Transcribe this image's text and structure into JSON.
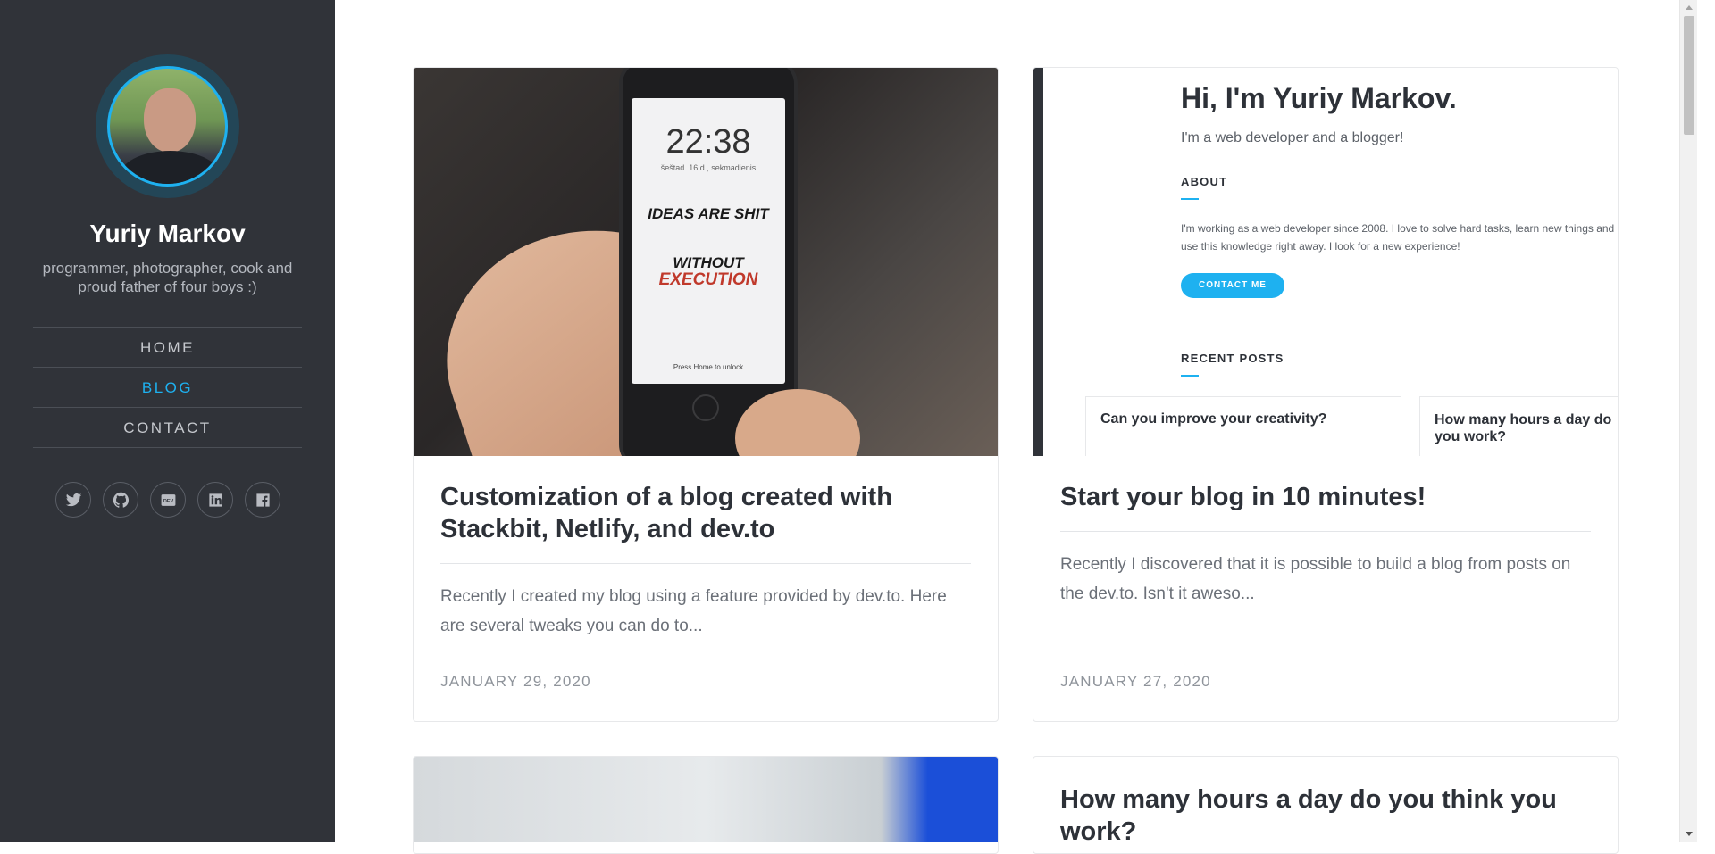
{
  "profile": {
    "name": "Yuriy Markov",
    "tagline": "programmer, photographer, cook and proud father of four boys :)"
  },
  "nav": {
    "items": [
      {
        "label": "HOME",
        "active": false
      },
      {
        "label": "BLOG",
        "active": true
      },
      {
        "label": "CONTACT",
        "active": false
      }
    ]
  },
  "social": [
    "twitter-icon",
    "github-icon",
    "dev-icon",
    "linkedin-icon",
    "facebook-icon"
  ],
  "colors": {
    "sidebar_bg": "#303339",
    "accent": "#1eb1f0",
    "title_text": "#2d3138",
    "muted_text": "#8f949b"
  },
  "posts": [
    {
      "title": "Customization of a blog created with Stackbit, Netlify, and dev.to",
      "excerpt": "Recently I created my blog using a feature provided by dev.to. Here are several tweaks you can do to...",
      "date": "JANUARY 29, 2020",
      "image": {
        "time": "22:38",
        "date_line": "šeštad. 16 d., sekmadienis",
        "quote_line1": "IDEAS ARE SHIT",
        "quote_line2": "WITHOUT",
        "quote_line3": "EXECUTION",
        "unlock": "Press Home to unlock"
      }
    },
    {
      "title": "Start your blog in 10 minutes!",
      "excerpt": "Recently I discovered that it is possible to build a blog from posts on the dev.to. Isn't it aweso...",
      "date": "JANUARY 27, 2020",
      "image": {
        "heading": "Hi, I'm Yuriy Markov.",
        "subheading": "I'm a web developer and a blogger!",
        "about_title": "ABOUT",
        "about_text": "I'm working as a web developer since 2008. I love to solve hard tasks, learn new things and use this knowledge right away. I look for a new experience!",
        "contact_button": "CONTACT ME",
        "recent_title": "RECENT POSTS",
        "recent_1": "Can you improve your creativity?",
        "recent_2": "How many hours a day do you work?"
      }
    },
    {
      "title": "How many hours a day do you think you work?"
    }
  ]
}
